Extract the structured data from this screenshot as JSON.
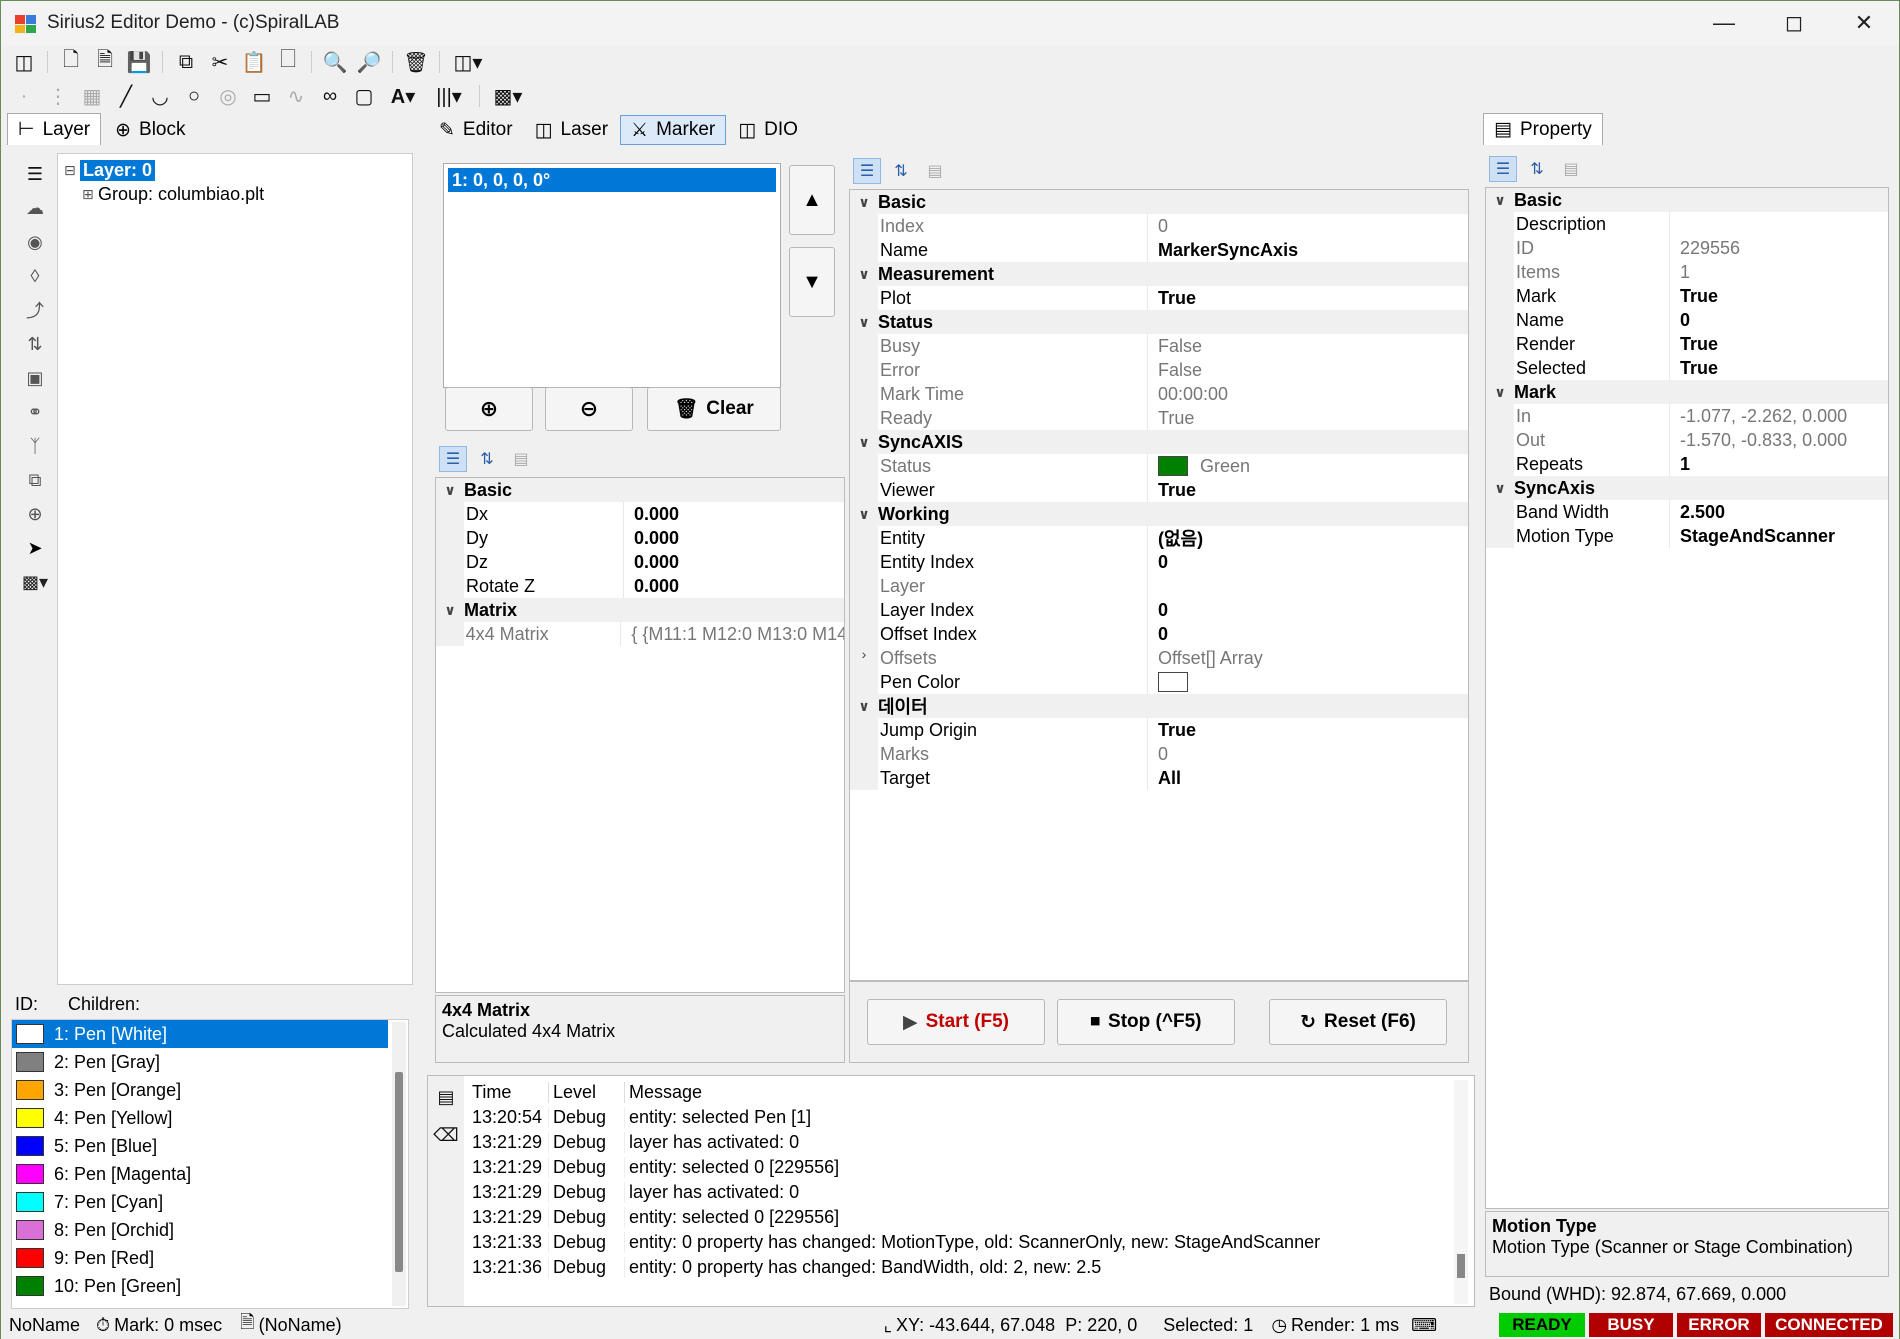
{
  "window": {
    "title": "Sirius2 Editor Demo - (c)SpiralLAB"
  },
  "left_tabs": [
    {
      "label": "Layer",
      "icon": "tree-icon"
    },
    {
      "label": "Block",
      "icon": "block-icon"
    }
  ],
  "tree": {
    "layer": "Layer: 0",
    "group": "Group: columbiao.plt"
  },
  "id_children": {
    "id_label": "ID:",
    "children_label": "Children:"
  },
  "pens": [
    {
      "label": "1: Pen [White]",
      "color": "#ffffff"
    },
    {
      "label": "2: Pen [Gray]",
      "color": "#808080"
    },
    {
      "label": "3: Pen [Orange]",
      "color": "#ffa500"
    },
    {
      "label": "4: Pen [Yellow]",
      "color": "#ffff00"
    },
    {
      "label": "5: Pen [Blue]",
      "color": "#0000ff"
    },
    {
      "label": "6: Pen [Magenta]",
      "color": "#ff00ff"
    },
    {
      "label": "7: Pen [Cyan]",
      "color": "#00ffff"
    },
    {
      "label": "8: Pen [Orchid]",
      "color": "#da70d6"
    },
    {
      "label": "9: Pen [Red]",
      "color": "#ff0000"
    },
    {
      "label": "10: Pen [Green]",
      "color": "#008000"
    }
  ],
  "center_tabs": [
    {
      "label": "Editor",
      "icon": "editor-icon"
    },
    {
      "label": "Laser",
      "icon": "laser-icon"
    },
    {
      "label": "Marker",
      "icon": "marker-icon"
    },
    {
      "label": "DIO",
      "icon": "dio-icon"
    }
  ],
  "offsets": {
    "selected": "1: 0, 0, 0, 0°"
  },
  "offset_buttons": {
    "clear": "Clear"
  },
  "offset_grid": [
    {
      "type": "cat",
      "name": "Basic"
    },
    {
      "name": "Dx",
      "value": "0.000",
      "bold": true
    },
    {
      "name": "Dy",
      "value": "0.000",
      "bold": true
    },
    {
      "name": "Dz",
      "value": "0.000",
      "bold": true
    },
    {
      "name": "Rotate Z",
      "value": "0.000",
      "bold": true
    },
    {
      "type": "cat",
      "name": "Matrix"
    },
    {
      "name": "4x4 Matrix",
      "value": "{ {M11:1 M12:0 M13:0 M14",
      "gray": true
    }
  ],
  "offset_desc": {
    "title": "4x4 Matrix",
    "text": "Calculated 4x4 Matrix"
  },
  "marker_grid": [
    {
      "type": "cat",
      "name": "Basic"
    },
    {
      "name": "Index",
      "value": "0",
      "gray": true
    },
    {
      "name": "Name",
      "value": "MarkerSyncAxis",
      "bold": true
    },
    {
      "type": "cat",
      "name": "Measurement"
    },
    {
      "name": "Plot",
      "value": "True",
      "bold": true
    },
    {
      "type": "cat",
      "name": "Status"
    },
    {
      "name": "Busy",
      "value": "False",
      "gray": true
    },
    {
      "name": "Error",
      "value": "False",
      "gray": true
    },
    {
      "name": "Mark Time",
      "value": "00:00:00",
      "gray": true
    },
    {
      "name": "Ready",
      "value": "True",
      "gray": true
    },
    {
      "type": "cat",
      "name": "SyncAXIS"
    },
    {
      "name": "Status",
      "value": "Green",
      "gray": true,
      "swatch": "#008000"
    },
    {
      "name": "Viewer",
      "value": "True",
      "bold": true
    },
    {
      "type": "cat",
      "name": "Working"
    },
    {
      "name": "Entity",
      "value": "(없음)",
      "bold": true
    },
    {
      "name": "Entity Index",
      "value": "0",
      "bold": true
    },
    {
      "name": "Layer",
      "value": "",
      "gray": true
    },
    {
      "name": "Layer Index",
      "value": "0",
      "bold": true
    },
    {
      "name": "Offset Index",
      "value": "0",
      "bold": true
    },
    {
      "name": "Offsets",
      "value": "Offset[] Array",
      "gray": true,
      "collapsed": true
    },
    {
      "name": "Pen Color",
      "value": "",
      "swatch": "#ffffff"
    },
    {
      "type": "cat",
      "name": "데이터"
    },
    {
      "name": "Jump Origin",
      "value": "True",
      "bold": true
    },
    {
      "name": "Marks",
      "value": "0",
      "gray": true
    },
    {
      "name": "Target",
      "value": "All",
      "bold": true
    }
  ],
  "marker_buttons": {
    "start": "Start (F5)",
    "stop": "Stop (^F5)",
    "reset": "Reset (F6)"
  },
  "property_tab": "Property",
  "property_grid": [
    {
      "type": "cat",
      "name": "Basic"
    },
    {
      "name": "Description",
      "value": ""
    },
    {
      "name": "ID",
      "value": "229556",
      "gray": true
    },
    {
      "name": "Items",
      "value": "1",
      "gray": true
    },
    {
      "name": "Mark",
      "value": "True",
      "bold": true
    },
    {
      "name": "Name",
      "value": "0",
      "bold": true
    },
    {
      "name": "Render",
      "value": "True",
      "bold": true
    },
    {
      "name": "Selected",
      "value": "True",
      "bold": true
    },
    {
      "type": "cat",
      "name": "Mark"
    },
    {
      "name": "In",
      "value": "-1.077, -2.262, 0.000",
      "gray": true
    },
    {
      "name": "Out",
      "value": "-1.570, -0.833, 0.000",
      "gray": true
    },
    {
      "name": "Repeats",
      "value": "1",
      "bold": true
    },
    {
      "type": "cat",
      "name": "SyncAxis"
    },
    {
      "name": "Band Width",
      "value": "2.500",
      "bold": true
    },
    {
      "name": "Motion Type",
      "value": "StageAndScanner",
      "bold": true
    }
  ],
  "property_desc": {
    "title": "Motion Type",
    "text": "Motion Type (Scanner or Stage Combination)"
  },
  "bound": "Bound (WHD): 92.874, 67.669, 0.000",
  "log": {
    "headers": [
      "Time",
      "Level",
      "Message"
    ],
    "rows": [
      [
        "13:20:54",
        "Debug",
        "entity: selected Pen [1]"
      ],
      [
        "13:21:29",
        "Debug",
        "layer has activated: 0"
      ],
      [
        "13:21:29",
        "Debug",
        "entity: selected 0 [229556]"
      ],
      [
        "13:21:29",
        "Debug",
        "layer has activated: 0"
      ],
      [
        "13:21:29",
        "Debug",
        "entity: selected 0 [229556]"
      ],
      [
        "13:21:33",
        "Debug",
        "entity: 0 property has changed: MotionType, old: ScannerOnly, new: StageAndScanner"
      ],
      [
        "13:21:36",
        "Debug",
        "entity: 0 property has changed: BandWidth, old: 2, new: 2.5"
      ]
    ]
  },
  "statusbar": {
    "file": "NoName",
    "mark": "Mark: 0 msec",
    "doc": "(NoName)",
    "xy": "XY: -43.644, 67.048",
    "p": "P: 220, 0",
    "selected": "Selected: 1",
    "render": "Render: 1 ms",
    "badges": [
      {
        "label": "READY",
        "color": "#00cc00",
        "text_color": "#000000"
      },
      {
        "label": "BUSY",
        "color": "#b00000",
        "text_color": "#ffffff"
      },
      {
        "label": "ERROR",
        "color": "#b00000",
        "text_color": "#ffffff"
      },
      {
        "label": "CONNECTED",
        "color": "#b00000",
        "text_color": "#ffffff"
      }
    ]
  }
}
